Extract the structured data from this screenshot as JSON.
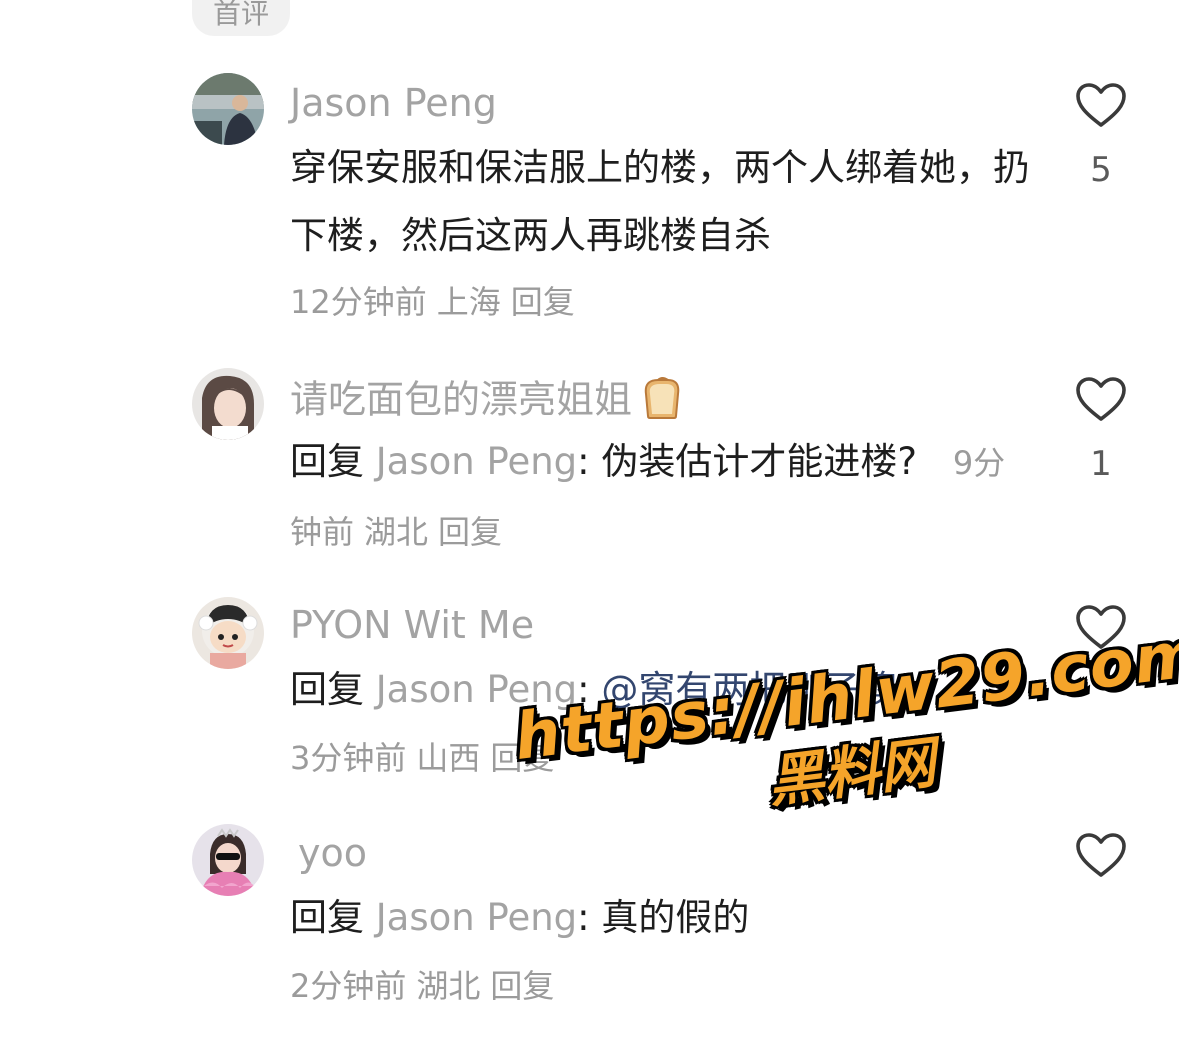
{
  "top_tag": "首评",
  "comments": [
    {
      "username": "Jason Peng",
      "text": "穿保安服和保洁服上的楼，两个人绑着她，扔下楼，然后这两人再跳楼自杀",
      "time": "12分钟前",
      "location": "上海",
      "reply_label": "回复",
      "likes": "5"
    },
    {
      "username": "请吃面包的漂亮姐姐",
      "username_emoji": "bread-emoji",
      "reply_prefix": "回复",
      "reply_target": "Jason Peng",
      "colon": ":",
      "text": " 伪装估计才能进楼?",
      "time": "9分钟前",
      "location": "湖北",
      "reply_label": "回复",
      "likes": "1"
    },
    {
      "username": "PYON Wit Me",
      "reply_prefix": "回复",
      "reply_target": "Jason Peng",
      "colon": ":",
      "mention": " @窝有两把刷子噢",
      "time": "3分钟前",
      "location": "山西",
      "reply_label": "回复",
      "likes": ""
    },
    {
      "username": "yoo",
      "reply_prefix": "回复",
      "reply_target": "Jason Peng",
      "colon": ":",
      "text": " 真的假的",
      "time": "2分钟前",
      "location": "湖北",
      "reply_label": "回复",
      "likes": ""
    }
  ],
  "watermark": {
    "url": "https://ihlw29.com",
    "subtitle": "黑料网"
  },
  "colors": {
    "username": "#a3a3a3",
    "body": "#1e1e1e",
    "meta": "#9b9b9b",
    "mention": "#33466f",
    "watermark_fill": "#f5a42a"
  }
}
